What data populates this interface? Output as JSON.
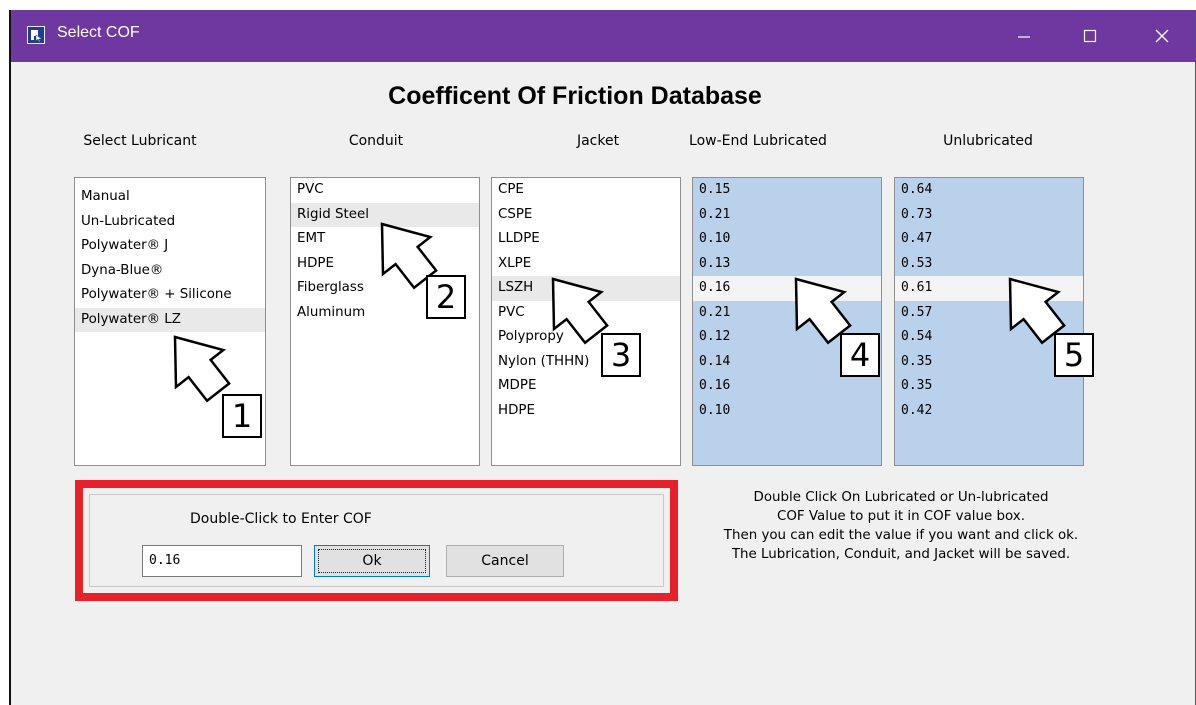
{
  "window": {
    "title": "Select COF"
  },
  "header": {
    "title": "Coefficent Of Friction Database"
  },
  "columns": {
    "lubricant": "Select Lubricant",
    "conduit": "Conduit",
    "jacket": "Jacket",
    "low_end": "Low-End Lubricated",
    "unlubricated": "Unlubricated"
  },
  "lubricants": [
    "Manual",
    "Un-Lubricated",
    "Polywater® J",
    "Dyna-Blue®",
    "Polywater® + Silicone",
    "Polywater® LZ"
  ],
  "conduits": [
    "PVC",
    "Rigid Steel",
    "EMT",
    "HDPE",
    "Fiberglass",
    "Aluminum"
  ],
  "jackets": [
    "CPE",
    "CSPE",
    "LLDPE",
    "XLPE",
    "LSZH",
    "PVC",
    "Polypropy",
    "Nylon (THHN)",
    "MDPE",
    "HDPE"
  ],
  "low_end_values": [
    "0.15",
    "0.21",
    "0.10",
    "0.13",
    "0.16",
    "0.21",
    "0.12",
    "0.14",
    "0.16",
    "0.10"
  ],
  "unlub_values": [
    "0.64",
    "0.73",
    "0.47",
    "0.53",
    "0.61",
    "0.57",
    "0.54",
    "0.35",
    "0.35",
    "0.42"
  ],
  "selection": {
    "lubricant": 5,
    "conduit": 1,
    "jacket": 4,
    "value_row": 4
  },
  "cof_panel": {
    "label": "Double-Click to Enter COF",
    "value": "0.16",
    "ok_label": "Ok",
    "cancel_label": "Cancel"
  },
  "help_lines": [
    "Double Click On Lubricated or Un-lubricated",
    "COF Value to put it in COF value box.",
    "Then you can edit the value if you want and click ok.",
    "The Lubrication, Conduit, and Jacket will be saved."
  ],
  "annotations": [
    "1",
    "2",
    "3",
    "4",
    "5"
  ],
  "colors": {
    "titlebar": "#6f38a0",
    "highlight_frame": "#e8202a",
    "value_list_bg": "#b9d1ea"
  },
  "icons": {
    "app": "app-icon",
    "minimize": "minimize-icon",
    "maximize": "maximize-icon",
    "close": "close-icon",
    "annotation": "arrow-pointer-icon"
  }
}
